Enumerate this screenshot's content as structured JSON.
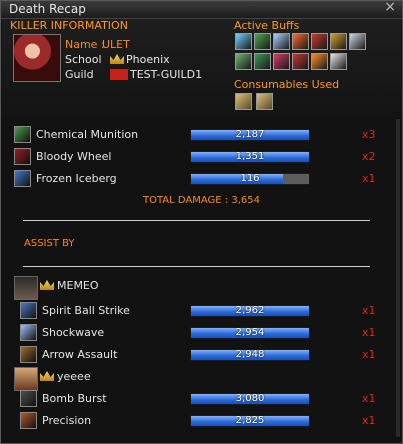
{
  "window": {
    "title": "Death Recap",
    "close_glyph": "×"
  },
  "killer": {
    "section_label": "KILLER INFORMATION",
    "name_label": "Name :",
    "name": "ULET",
    "school_label": "School",
    "school": "Phoenix",
    "guild_label": "Guild",
    "guild": "TEST-GUILD1"
  },
  "buffs": {
    "label": "Active Buffs",
    "icons": [
      "buff-icon-1",
      "buff-icon-2",
      "buff-icon-3",
      "buff-icon-4",
      "buff-icon-5",
      "buff-icon-6",
      "buff-icon-7",
      "buff-icon-8",
      "buff-icon-9",
      "buff-icon-10",
      "buff-icon-11",
      "buff-icon-12",
      "buff-icon-13"
    ]
  },
  "consumables": {
    "label": "Consumables Used",
    "icons": [
      "consumable-icon-1",
      "consumable-icon-2"
    ]
  },
  "killer_skills": [
    {
      "name": "Chemical Munition",
      "damage": "2,187",
      "hits": "x3",
      "fill_fraction": 1.0
    },
    {
      "name": "Bloody Wheel",
      "damage": "1,351",
      "hits": "x2",
      "fill_fraction": 1.0
    },
    {
      "name": "Frozen Iceberg",
      "damage": "116",
      "hits": "x1",
      "fill_fraction": 0.78
    }
  ],
  "total_damage": "TOTAL DAMAGE : 3,654",
  "assist": {
    "label": "ASSIST BY",
    "players": [
      {
        "name": "MEMEO",
        "skills": [
          {
            "name": "Spirit Ball Strike",
            "damage": "2,962",
            "hits": "x1",
            "fill_fraction": 1.0
          },
          {
            "name": "Shockwave",
            "damage": "2,954",
            "hits": "x1",
            "fill_fraction": 1.0
          },
          {
            "name": "Arrow Assault",
            "damage": "2,948",
            "hits": "x1",
            "fill_fraction": 1.0
          }
        ]
      },
      {
        "name": "yeeee",
        "skills": [
          {
            "name": "Bomb Burst",
            "damage": "3,080",
            "hits": "x1",
            "fill_fraction": 1.0
          },
          {
            "name": "Precision",
            "damage": "2,825",
            "hits": "x1",
            "fill_fraction": 1.0
          }
        ]
      }
    ]
  },
  "colors": {
    "accent": "#ff8a1e",
    "bar": "#2f6cd8",
    "multiplier": "#d62b1e"
  }
}
